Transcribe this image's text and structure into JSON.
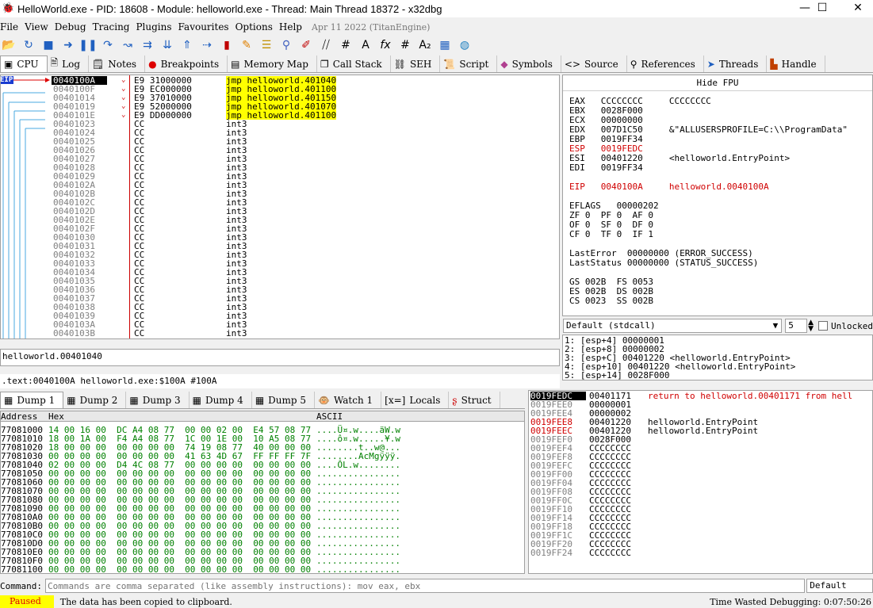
{
  "window": {
    "title": "HelloWorld.exe - PID: 18608 - Module: helloworld.exe - Thread: Main Thread 18372 - x32dbg",
    "minimize": "—",
    "maximize": "☐",
    "close": "✕"
  },
  "menu": {
    "items": [
      "File",
      "View",
      "Debug",
      "Tracing",
      "Plugins",
      "Favourites",
      "Options",
      "Help"
    ],
    "build_date": "Apr 11 2022 (TitanEngine)"
  },
  "tabs": [
    {
      "label": "CPU",
      "icon": "cpu-icon"
    },
    {
      "label": "Log",
      "icon": "log-icon"
    },
    {
      "label": "Notes",
      "icon": "notes-icon"
    },
    {
      "label": "Breakpoints",
      "icon": "breakpoint-icon"
    },
    {
      "label": "Memory Map",
      "icon": "memory-map-icon"
    },
    {
      "label": "Call Stack",
      "icon": "call-stack-icon"
    },
    {
      "label": "SEH",
      "icon": "seh-icon"
    },
    {
      "label": "Script",
      "icon": "script-icon"
    },
    {
      "label": "Symbols",
      "icon": "symbols-icon"
    },
    {
      "label": "Source",
      "icon": "source-icon"
    },
    {
      "label": "References",
      "icon": "references-icon"
    },
    {
      "label": "Threads",
      "icon": "threads-icon"
    },
    {
      "label": "Handle",
      "icon": "handles-icon"
    }
  ],
  "disasm": {
    "eip_label": "EIP",
    "rows": [
      {
        "addr": "0040100A",
        "bytes": "E9 31000000",
        "instr": "jmp helloworld.401040",
        "jmp": true,
        "cur": true
      },
      {
        "addr": "0040100F",
        "bytes": "E9 EC000000",
        "instr": "jmp helloworld.401100",
        "jmp": true
      },
      {
        "addr": "00401014",
        "bytes": "E9 37010000",
        "instr": "jmp helloworld.401150",
        "jmp": true
      },
      {
        "addr": "00401019",
        "bytes": "E9 52000000",
        "instr": "jmp helloworld.401070",
        "jmp": true
      },
      {
        "addr": "0040101E",
        "bytes": "E9 DD000000",
        "instr": "jmp helloworld.401100",
        "jmp": true
      },
      {
        "addr": "00401023",
        "bytes": "CC",
        "instr": "int3"
      },
      {
        "addr": "00401024",
        "bytes": "CC",
        "instr": "int3"
      },
      {
        "addr": "00401025",
        "bytes": "CC",
        "instr": "int3"
      },
      {
        "addr": "00401026",
        "bytes": "CC",
        "instr": "int3"
      },
      {
        "addr": "00401027",
        "bytes": "CC",
        "instr": "int3"
      },
      {
        "addr": "00401028",
        "bytes": "CC",
        "instr": "int3"
      },
      {
        "addr": "00401029",
        "bytes": "CC",
        "instr": "int3"
      },
      {
        "addr": "0040102A",
        "bytes": "CC",
        "instr": "int3"
      },
      {
        "addr": "0040102B",
        "bytes": "CC",
        "instr": "int3"
      },
      {
        "addr": "0040102C",
        "bytes": "CC",
        "instr": "int3"
      },
      {
        "addr": "0040102D",
        "bytes": "CC",
        "instr": "int3"
      },
      {
        "addr": "0040102E",
        "bytes": "CC",
        "instr": "int3"
      },
      {
        "addr": "0040102F",
        "bytes": "CC",
        "instr": "int3"
      },
      {
        "addr": "00401030",
        "bytes": "CC",
        "instr": "int3"
      },
      {
        "addr": "00401031",
        "bytes": "CC",
        "instr": "int3"
      },
      {
        "addr": "00401032",
        "bytes": "CC",
        "instr": "int3"
      },
      {
        "addr": "00401033",
        "bytes": "CC",
        "instr": "int3"
      },
      {
        "addr": "00401034",
        "bytes": "CC",
        "instr": "int3"
      },
      {
        "addr": "00401035",
        "bytes": "CC",
        "instr": "int3"
      },
      {
        "addr": "00401036",
        "bytes": "CC",
        "instr": "int3"
      },
      {
        "addr": "00401037",
        "bytes": "CC",
        "instr": "int3"
      },
      {
        "addr": "00401038",
        "bytes": "CC",
        "instr": "int3"
      },
      {
        "addr": "00401039",
        "bytes": "CC",
        "instr": "int3"
      },
      {
        "addr": "0040103A",
        "bytes": "CC",
        "instr": "int3"
      },
      {
        "addr": "0040103B",
        "bytes": "CC",
        "instr": "int3"
      }
    ]
  },
  "info_text": "helloworld.00401040",
  "info_location": ".text:0040100A helloworld.exe:$100A #100A",
  "registers": {
    "header": "Hide FPU",
    "lines": [
      {
        "text": "EAX   CCCCCCCC     CCCCCCCC"
      },
      {
        "text": "EBX   0028F000"
      },
      {
        "text": "ECX   00000000"
      },
      {
        "text": "EDX   007D1C50     &\"ALLUSERSPROFILE=C:\\\\ProgramData\""
      },
      {
        "text": "EBP   0019FF34"
      },
      {
        "text": "ESP   0019FEDC",
        "red": true
      },
      {
        "text": "ESI   00401220     <helloworld.EntryPoint>"
      },
      {
        "text": "EDI   0019FF34"
      },
      {
        "text": ""
      },
      {
        "text": "EIP   0040100A     helloworld.0040100A",
        "red": true
      },
      {
        "text": ""
      },
      {
        "text": "EFLAGS   00000202"
      },
      {
        "text": "ZF 0  PF 0  AF 0"
      },
      {
        "text": "OF 0  SF 0  DF 0"
      },
      {
        "text": "CF 0  TF 0  IF 1"
      },
      {
        "text": ""
      },
      {
        "text": "LastError  00000000 (ERROR_SUCCESS)"
      },
      {
        "text": "LastStatus 00000000 (STATUS_SUCCESS)"
      },
      {
        "text": ""
      },
      {
        "text": "GS 002B  FS 0053"
      },
      {
        "text": "ES 002B  DS 002B"
      },
      {
        "text": "CS 0023  SS 002B"
      }
    ]
  },
  "callconv": {
    "selected": "Default (stdcall)",
    "count": "5",
    "unlocked_label": "Unlocked"
  },
  "stack_args": [
    "1: [esp+4] 00000001",
    "2: [esp+8] 00000002",
    "3: [esp+C] 00401220 <helloworld.EntryPoint>",
    "4: [esp+10] 00401220 <helloworld.EntryPoint>",
    "5: [esp+14] 0028F000"
  ],
  "dump_tabs": [
    "Dump 1",
    "Dump 2",
    "Dump 3",
    "Dump 4",
    "Dump 5",
    "Watch 1",
    "Locals",
    "Struct"
  ],
  "dump": {
    "col_address": "Address",
    "col_hex": "Hex",
    "col_ascii": "ASCII",
    "rows": [
      {
        "addr": "77081000",
        "hex": "14 00 16 00  DC A4 08 77  00 00 02 00  E4 57 08 77",
        "ascii": "....Ü¤.w....äW.w"
      },
      {
        "addr": "77081010",
        "hex": "18 00 1A 00  F4 A4 08 77  1C 00 1E 00  10 A5 08 77",
        "ascii": "....ô¤.w.....¥.w"
      },
      {
        "addr": "77081020",
        "hex": "18 00 00 00  00 00 00 00  74 19 08 77  40 00 00 00",
        "ascii": "........t..w@..."
      },
      {
        "addr": "77081030",
        "hex": "00 00 00 00  00 00 00 00  41 63 4D 67  FF FF FF 7F",
        "ascii": "........AcMgÿÿÿ."
      },
      {
        "addr": "77081040",
        "hex": "02 00 00 00  D4 4C 08 77  00 00 00 00  00 00 00 00",
        "ascii": "....ÔL.w........"
      },
      {
        "addr": "77081050",
        "hex": "00 00 00 00  00 00 00 00  00 00 00 00  00 00 00 00",
        "ascii": "................"
      },
      {
        "addr": "77081060",
        "hex": "00 00 00 00  00 00 00 00  00 00 00 00  00 00 00 00",
        "ascii": "................"
      },
      {
        "addr": "77081070",
        "hex": "00 00 00 00  00 00 00 00  00 00 00 00  00 00 00 00",
        "ascii": "................"
      },
      {
        "addr": "77081080",
        "hex": "00 00 00 00  00 00 00 00  00 00 00 00  00 00 00 00",
        "ascii": "................"
      },
      {
        "addr": "77081090",
        "hex": "00 00 00 00  00 00 00 00  00 00 00 00  00 00 00 00",
        "ascii": "................"
      },
      {
        "addr": "770810A0",
        "hex": "00 00 00 00  00 00 00 00  00 00 00 00  00 00 00 00",
        "ascii": "................"
      },
      {
        "addr": "770810B0",
        "hex": "00 00 00 00  00 00 00 00  00 00 00 00  00 00 00 00",
        "ascii": "................"
      },
      {
        "addr": "770810C0",
        "hex": "00 00 00 00  00 00 00 00  00 00 00 00  00 00 00 00",
        "ascii": "................"
      },
      {
        "addr": "770810D0",
        "hex": "00 00 00 00  00 00 00 00  00 00 00 00  00 00 00 00",
        "ascii": "................"
      },
      {
        "addr": "770810E0",
        "hex": "00 00 00 00  00 00 00 00  00 00 00 00  00 00 00 00",
        "ascii": "................"
      },
      {
        "addr": "770810F0",
        "hex": "00 00 00 00  00 00 00 00  00 00 00 00  00 00 00 00",
        "ascii": "................"
      },
      {
        "addr": "77081100",
        "hex": "00 00 00 00  00 00 00 00  00 00 00 00  00 00 00 00",
        "ascii": "................"
      }
    ]
  },
  "stack": {
    "rows": [
      {
        "addr": "0019FEDC",
        "val": "00401171",
        "comment": "return to helloworld.00401171 from hell",
        "cur": true
      },
      {
        "addr": "0019FEE0",
        "val": "00000001",
        "comment": ""
      },
      {
        "addr": "0019FEE4",
        "val": "00000002",
        "comment": ""
      },
      {
        "addr": "0019FEE8",
        "val": "00401220",
        "comment": "helloworld.EntryPoint",
        "red": true
      },
      {
        "addr": "0019FEEC",
        "val": "00401220",
        "comment": "helloworld.EntryPoint",
        "red": true
      },
      {
        "addr": "0019FEF0",
        "val": "0028F000",
        "comment": ""
      },
      {
        "addr": "0019FEF4",
        "val": "CCCCCCCC",
        "comment": ""
      },
      {
        "addr": "0019FEF8",
        "val": "CCCCCCCC",
        "comment": ""
      },
      {
        "addr": "0019FEFC",
        "val": "CCCCCCCC",
        "comment": ""
      },
      {
        "addr": "0019FF00",
        "val": "CCCCCCCC",
        "comment": ""
      },
      {
        "addr": "0019FF04",
        "val": "CCCCCCCC",
        "comment": ""
      },
      {
        "addr": "0019FF08",
        "val": "CCCCCCCC",
        "comment": ""
      },
      {
        "addr": "0019FF0C",
        "val": "CCCCCCCC",
        "comment": ""
      },
      {
        "addr": "0019FF10",
        "val": "CCCCCCCC",
        "comment": ""
      },
      {
        "addr": "0019FF14",
        "val": "CCCCCCCC",
        "comment": ""
      },
      {
        "addr": "0019FF18",
        "val": "CCCCCCCC",
        "comment": ""
      },
      {
        "addr": "0019FF1C",
        "val": "CCCCCCCC",
        "comment": ""
      },
      {
        "addr": "0019FF20",
        "val": "CCCCCCCC",
        "comment": ""
      },
      {
        "addr": "0019FF24",
        "val": "CCCCCCCC",
        "comment": ""
      }
    ]
  },
  "command": {
    "label": "Command:",
    "placeholder": "Commands are comma separated (like assembly instructions): mov eax, ebx",
    "mode": "Default"
  },
  "status": {
    "state": "Paused",
    "message": "The data has been copied to clipboard.",
    "time_wasted": "Time Wasted Debugging: 0:07:50:26"
  },
  "colors": {
    "jmp_highlight": "#ffff00",
    "paused": "#ffff00",
    "red": "#d00000"
  }
}
